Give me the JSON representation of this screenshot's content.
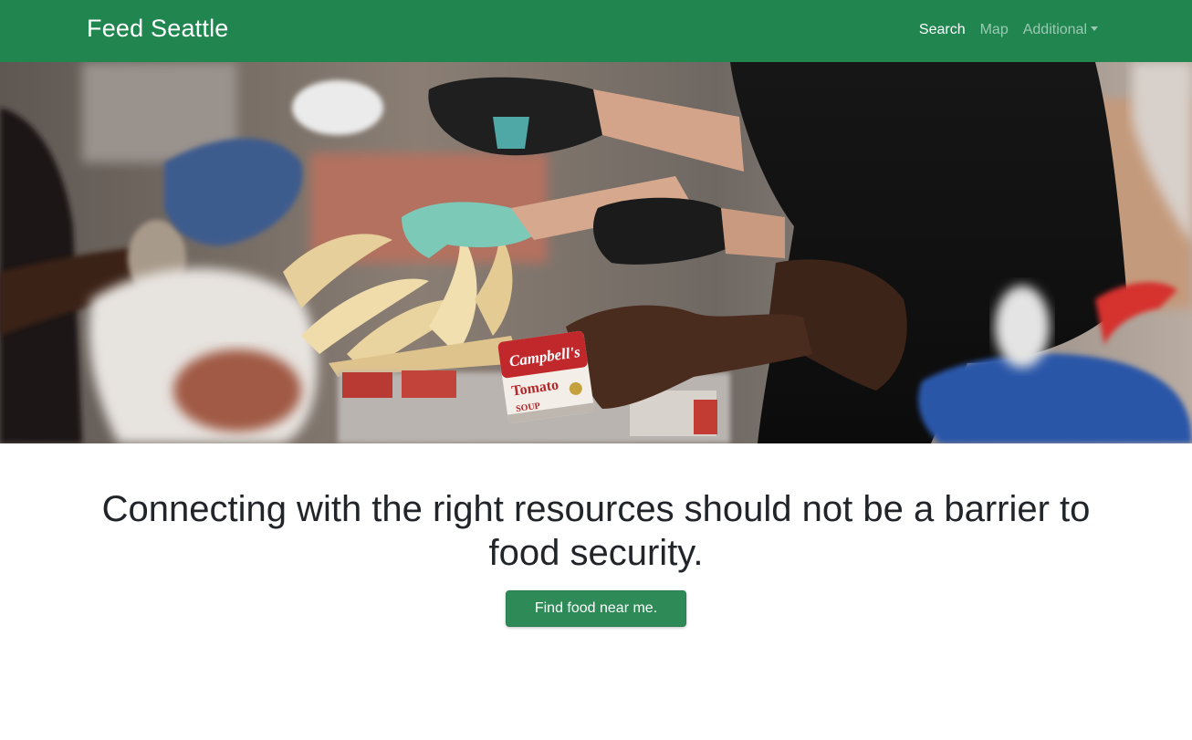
{
  "navbar": {
    "brand": "Feed Seattle",
    "links": [
      {
        "label": "Search",
        "active": true
      },
      {
        "label": "Map",
        "active": false
      },
      {
        "label": "Additional",
        "active": false,
        "dropdown": true
      }
    ],
    "color": "#218550"
  },
  "hero": {
    "can_brand": "Campbell's",
    "can_label": "Tomato",
    "can_sublabel": "SOUP"
  },
  "main": {
    "tagline": "Connecting with the right resources should not be a barrier to food security.",
    "cta_label": "Find food near me.",
    "cta_color": "#2e8b57"
  }
}
